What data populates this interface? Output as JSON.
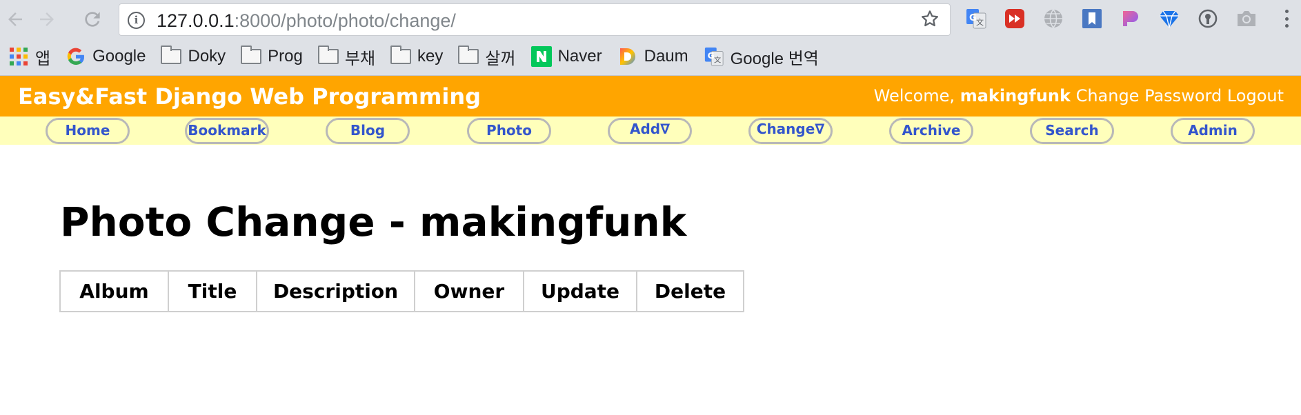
{
  "browser": {
    "url_host": "127.0.0.1",
    "url_rest": ":8000/photo/photo/change/",
    "icons": {
      "back": "arrow-left-icon",
      "forward": "arrow-right-icon",
      "reload": "reload-icon",
      "info": "info-icon",
      "bookmark_star": "star-icon"
    },
    "extensions": [
      "google-translate-icon",
      "youtube-ff-icon",
      "globe-icon",
      "bookmark-icon",
      "palette-icon",
      "diamond-icon",
      "lock-ext-icon",
      "camera-icon"
    ],
    "bookmarks": [
      {
        "label": "앱",
        "icon": "apps-grid-icon"
      },
      {
        "label": "Google",
        "icon": "google-icon"
      },
      {
        "label": "Doky",
        "icon": "folder-icon"
      },
      {
        "label": "Prog",
        "icon": "folder-icon"
      },
      {
        "label": "부채",
        "icon": "folder-icon"
      },
      {
        "label": "key",
        "icon": "folder-icon"
      },
      {
        "label": "살꺼",
        "icon": "folder-icon"
      },
      {
        "label": "Naver",
        "icon": "naver-icon"
      },
      {
        "label": "Daum",
        "icon": "daum-icon"
      },
      {
        "label": "Google 번역",
        "icon": "google-translate-icon"
      }
    ]
  },
  "header": {
    "site_title": "Easy&Fast Django Web Programming",
    "welcome": "Welcome,",
    "username": "makingfunk",
    "change_password": "Change Password",
    "logout": "Logout",
    "accent_color": "#ffa500",
    "menu_bg": "#ffffbb",
    "menu_text_color": "#3355cc"
  },
  "menu": {
    "home": "Home",
    "bookmark": "Bookmark",
    "blog": "Blog",
    "photo": "Photo",
    "add": "Add∇",
    "change": "Change∇",
    "archive": "Archive",
    "search": "Search",
    "admin": "Admin"
  },
  "main": {
    "title": "Photo Change - makingfunk",
    "table_headers": [
      "Album",
      "Title",
      "Description",
      "Owner",
      "Update",
      "Delete"
    ]
  }
}
